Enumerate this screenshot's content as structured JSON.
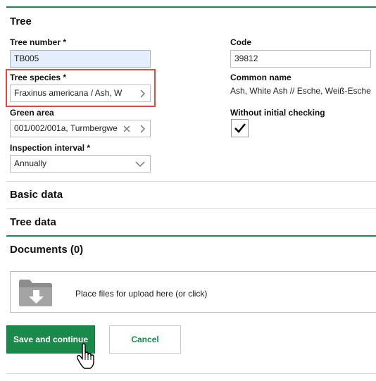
{
  "tree_section": {
    "title": "Tree",
    "tree_number": {
      "label": "Tree number *",
      "value": "TB005"
    },
    "code": {
      "label": "Code",
      "value": "39812"
    },
    "tree_species": {
      "label": "Tree species *",
      "value": "Fraxinus americana / Ash, W"
    },
    "common_name": {
      "label": "Common name",
      "value": "Ash, White Ash // Esche, Weiß-Esche"
    },
    "green_area": {
      "label": "Green area",
      "value": "001/002/001a, Turmbergwe"
    },
    "without_initial_checking": {
      "label": "Without initial checking",
      "checked": true
    },
    "inspection_interval": {
      "label": "Inspection interval *",
      "value": "Annually"
    }
  },
  "sections": {
    "basic_data": "Basic data",
    "tree_data": "Tree data",
    "documents": "Documents (0)"
  },
  "upload": {
    "text": "Place files for upload here (or click)"
  },
  "actions": {
    "save_label": "Save and continue",
    "cancel_label": "Cancel"
  },
  "colors": {
    "accent": "#1a8a4a",
    "highlight_frame": "#e04848",
    "field_highlight": "#e4eefc"
  },
  "icons": [
    "chevron-right-icon",
    "clear-x-icon",
    "chevron-down-icon",
    "checkmark-icon",
    "folder-download-icon",
    "hand-pointer-icon"
  ]
}
